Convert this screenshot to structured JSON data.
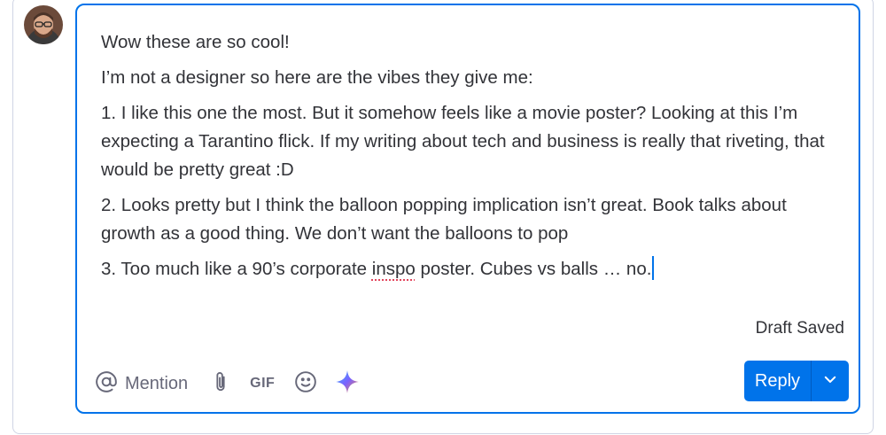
{
  "user": {
    "avatar": "avatar-photo"
  },
  "editor": {
    "paragraphs": [
      "Wow these are so cool!",
      "I’m not a designer so here are the vibes they give me:",
      "1. I like this one the most. But it somehow feels like a movie poster? Looking at this I’m expecting a Tarantino flick. If my writing about tech and business is really that riveting, that would be pretty great :D",
      "2. Looks pretty but I think the balloon popping implication isn’t great. Book talks about growth as a good thing. We don’t want the balloons to pop"
    ],
    "last_paragraph": {
      "before": "3. Too much like a 90’s corporate ",
      "misspelled": "inspo",
      "after": " poster. Cubes vs balls … no."
    },
    "status": "Draft Saved"
  },
  "toolbar": {
    "mention_icon": "at-sign-icon",
    "mention_label": "Mention",
    "attach_icon": "paperclip-icon",
    "gif_label": "GIF",
    "emoji_icon": "smiley-icon",
    "ai_icon": "sparkle-icon"
  },
  "reply": {
    "label": "Reply",
    "dropdown_icon": "chevron-down-icon",
    "color": "#0073ea"
  }
}
